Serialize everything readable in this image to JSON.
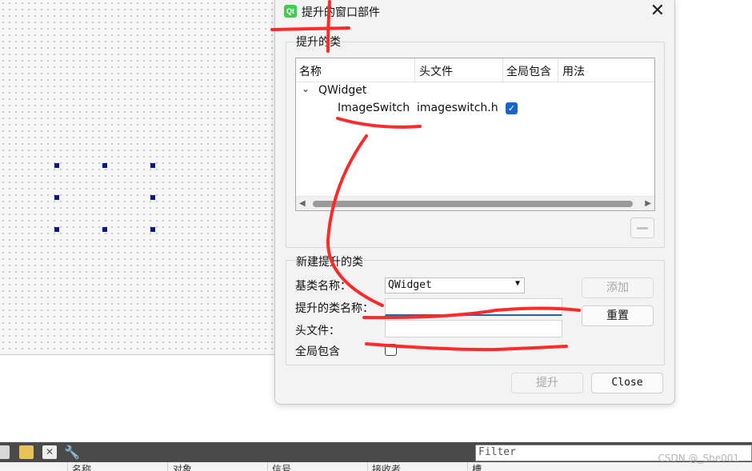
{
  "dialog": {
    "title": "提升的窗口部件",
    "promoted_group_title": "提升的类",
    "columns": [
      "名称",
      "头文件",
      "全局包含",
      "用法"
    ],
    "tree": {
      "parent": "QWidget",
      "child_name": "ImageSwitch",
      "child_header": "imageswitch.h",
      "child_global_include": true
    },
    "new_group_title": "新建提升的类",
    "base_class_label": "基类名称：",
    "base_class_value": "QWidget",
    "promoted_class_label": "提升的类名称：",
    "promoted_class_value": "",
    "header_label": "头文件：",
    "header_value": "",
    "global_include_label": "全局包含",
    "add_button": "添加",
    "reset_button": "重置",
    "promote_button": "提升",
    "close_button": "Close"
  },
  "bottom": {
    "filter_placeholder": "Filter",
    "columns": [
      "名称",
      "对象",
      "信号",
      "接收者",
      "槽"
    ],
    "watermark": "CSDN @_She001"
  },
  "colors": {
    "accent": "#1a64c8",
    "annotation": "#ff2a2a",
    "handle": "#0b1a80",
    "qt_green": "#41cd52"
  }
}
